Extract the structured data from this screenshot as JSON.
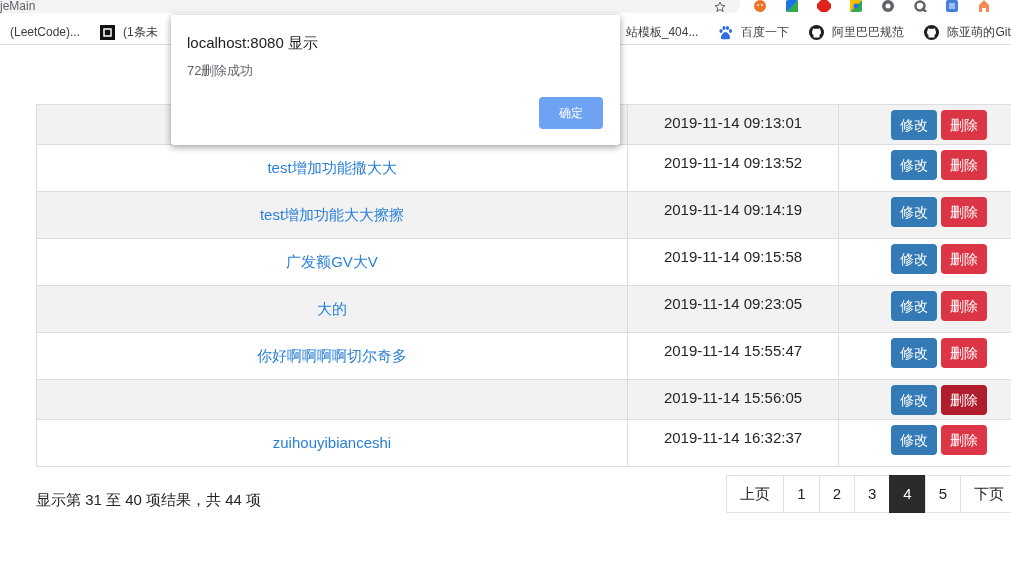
{
  "browser": {
    "address_text": "jeMain"
  },
  "bookmarks": [
    {
      "kind": "text",
      "label": "(LeetCode)..."
    },
    {
      "kind": "tile",
      "label": "(1条未"
    },
    {
      "kind": "text",
      "label": "站模板_404..."
    },
    {
      "kind": "paw",
      "label": "百度一下"
    },
    {
      "kind": "round",
      "label": "阿里巴巴规范"
    },
    {
      "kind": "round",
      "label": "陈亚萌的Git"
    }
  ],
  "table": {
    "rows": [
      {
        "date": "2019-11-14 09:13:01",
        "edit_label": "修改",
        "delete_label": "删除",
        "delete_hovered": false
      },
      {
        "title": "test增加功能撒大大",
        "date": "2019-11-14 09:13:52",
        "edit_label": "修改",
        "delete_label": "删除",
        "delete_hovered": false
      },
      {
        "title": "test增加功能大大擦擦",
        "date": "2019-11-14 09:14:19",
        "edit_label": "修改",
        "delete_label": "删除",
        "delete_hovered": false
      },
      {
        "title": "广发额GV大V",
        "date": "2019-11-14 09:15:58",
        "edit_label": "修改",
        "delete_label": "删除",
        "delete_hovered": false
      },
      {
        "title": "大的",
        "date": "2019-11-14 09:23:05",
        "edit_label": "修改",
        "delete_label": "删除",
        "delete_hovered": false
      },
      {
        "title": "你好啊啊啊啊切尔奇多",
        "date": "2019-11-14 15:55:47",
        "edit_label": "修改",
        "delete_label": "删除",
        "delete_hovered": false
      },
      {
        "date": "2019-11-14 15:56:05",
        "edit_label": "修改",
        "delete_label": "删除",
        "delete_hovered": true
      },
      {
        "title": "zuihouyibianceshi",
        "date": "2019-11-14 16:32:37",
        "edit_label": "修改",
        "delete_label": "删除",
        "delete_hovered": false
      }
    ]
  },
  "results_summary": "显示第 31 至 40 项结果，共 44 项",
  "pagination": [
    {
      "label": "上页",
      "selected": false
    },
    {
      "label": "1",
      "selected": false
    },
    {
      "label": "2",
      "selected": false
    },
    {
      "label": "3",
      "selected": false
    },
    {
      "label": "4",
      "selected": true
    },
    {
      "label": "5",
      "selected": false
    },
    {
      "label": "下页",
      "selected": false
    }
  ],
  "dialog": {
    "title": "localhost:8080 显示",
    "message": "72删除成功",
    "button": "确定"
  }
}
